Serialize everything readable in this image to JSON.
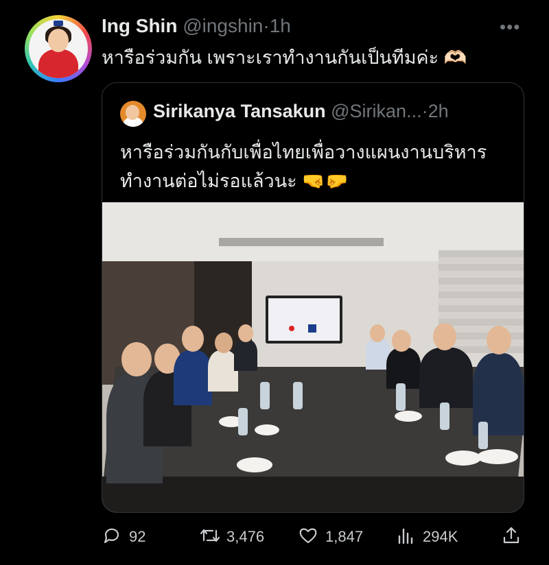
{
  "tweet": {
    "author_name": "Ing Shin",
    "author_handle": "@ingshin",
    "separator": "·",
    "time": "1h",
    "text": "หารือร่วมกัน เพราะเราทำงานกันเป็นทีมค่ะ 🫶🏻",
    "more_icon": "more-dots-icon"
  },
  "quote": {
    "author_name": "Sirikanya Tansakun",
    "author_handle": "@Sirikan...",
    "separator": "·",
    "time": "2h",
    "text": "หารือร่วมกันกับเพื่อไทยเพื่อวางแผนงานบริหาร ทำงานต่อไม่รอแล้วนะ 🤜🤛"
  },
  "metrics": {
    "replies": "92",
    "retweets": "3,476",
    "likes": "1,847",
    "views": "294K"
  }
}
